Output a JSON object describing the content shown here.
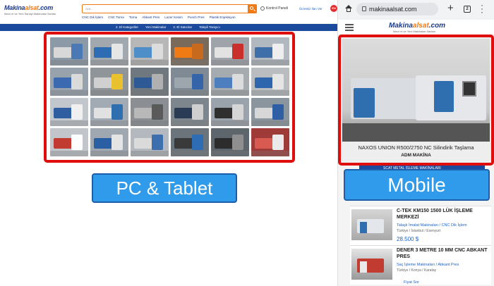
{
  "pc": {
    "logo_main": "Makina",
    "logo_accent": "alsat",
    "logo_suffix": ".com",
    "tagline": "İkinci el ve Yeni Sanayi Makinaları İlanları",
    "search_placeholder": "Ara...",
    "user_label": "Kontrol Paneli",
    "action_label": "Ücretsiz İlan Ver",
    "lang": "EN",
    "categories": [
      "CNC Dik İşlem",
      "CNC Torna",
      "Torna",
      "Abkant Pres",
      "Lazer Kesim",
      "Punch Pres",
      "Plastik Enjeksiyon"
    ],
    "nav": [
      "2. El Kategoriler",
      "Yeni Makinalar",
      "2. El Satıcılar",
      "Talepli Tarayıcı"
    ],
    "grid_tiles": [
      {
        "bg": "#8c9aa8",
        "m1": "#d8d8d8",
        "m2": "#4a79b6"
      },
      {
        "bg": "#a1a8ae",
        "m1": "#2e6db3",
        "m2": "#e6e6e6"
      },
      {
        "bg": "#b7b7b7",
        "m1": "#4e8fca",
        "m2": "#dcdcdc"
      },
      {
        "bg": "#7a6a5a",
        "m1": "#f07a13",
        "m2": "#c86a1e"
      },
      {
        "bg": "#9ea4aa",
        "m1": "#e2e2e2",
        "m2": "#c9302c"
      },
      {
        "bg": "#b1b8bf",
        "m1": "#3f6fa8",
        "m2": "#eeeeee"
      },
      {
        "bg": "#97a2ad",
        "m1": "#3b6ab0",
        "m2": "#dadada"
      },
      {
        "bg": "#8f9599",
        "m1": "#d0d0d0",
        "m2": "#e9c12f"
      },
      {
        "bg": "#6f777f",
        "m1": "#2d5a95",
        "m2": "#b0b0b0"
      },
      {
        "bg": "#7f8a94",
        "m1": "#9ea6ad",
        "m2": "#3565a8"
      },
      {
        "bg": "#a5abaf",
        "m1": "#4d7fbe",
        "m2": "#dcdcdc"
      },
      {
        "bg": "#b9bdc0",
        "m1": "#2d66ad",
        "m2": "#e5e5e5"
      },
      {
        "bg": "#c1c7cd",
        "m1": "#2f5fa0",
        "m2": "#f0f0f0"
      },
      {
        "bg": "#a2abb3",
        "m1": "#e1e1e1",
        "m2": "#2f6fb0"
      },
      {
        "bg": "#8b8f93",
        "m1": "#b8b8b8",
        "m2": "#5a5a5a"
      },
      {
        "bg": "#7e868d",
        "m1": "#2a3c55",
        "m2": "#cfcfcf"
      },
      {
        "bg": "#9aa3ab",
        "m1": "#2f2f2f",
        "m2": "#d5d5d5"
      },
      {
        "bg": "#8b959e",
        "m1": "#d7d7d7",
        "m2": "#2e5fa5"
      },
      {
        "bg": "#c2c6ca",
        "m1": "#c23b30",
        "m2": "#ffffff"
      },
      {
        "bg": "#9fa8b1",
        "m1": "#2a5fa3",
        "m2": "#e4e4e4"
      },
      {
        "bg": "#b3b9be",
        "m1": "#dadada",
        "m2": "#3d6eae"
      },
      {
        "bg": "#6c747b",
        "m1": "#3a3a3a",
        "m2": "#2e6db3"
      },
      {
        "bg": "#5e666d",
        "m1": "#2c2c2c",
        "m2": "#8f8f8f"
      },
      {
        "bg": "#9e3a38",
        "m1": "#d85a50",
        "m2": "#eaeaea"
      }
    ]
  },
  "labels": {
    "pc_button": "PC & Tablet",
    "mobile_button": "Mobile"
  },
  "mobile": {
    "url": "makinaalsat.com",
    "tab_count": "2",
    "logo_main": "Makina",
    "logo_accent": "alsat",
    "logo_suffix": ".com",
    "tagline": "İkinci el ve Yeni Makinaları İlanları",
    "hero_caption": "NAXOS UNION R500/2750 NC Silindirik Taşlama",
    "hero_seller": "ADM MAKİNA",
    "banner_text": "SCAT METAL İŞLEME MAKİNALARI",
    "listings": [
      {
        "title": "C-TEK KM150 1500 LÜK İŞLEME MERKEZİ",
        "categories": "Talaşlı İmalat Makinaları  / CNC Dik İşlem",
        "location": "Türkiye / İstanbul / Esenyurt",
        "price": "28.500 $",
        "price2": ""
      },
      {
        "title": "DENER 3 METRE 10 MM CNC ABKANT PRES",
        "categories": "Saç İşleme Makinaları  / Abkant Pres",
        "location": "Türkiye / Konya / Karatay",
        "price": "",
        "price2": "Fiyat Sor"
      }
    ]
  }
}
